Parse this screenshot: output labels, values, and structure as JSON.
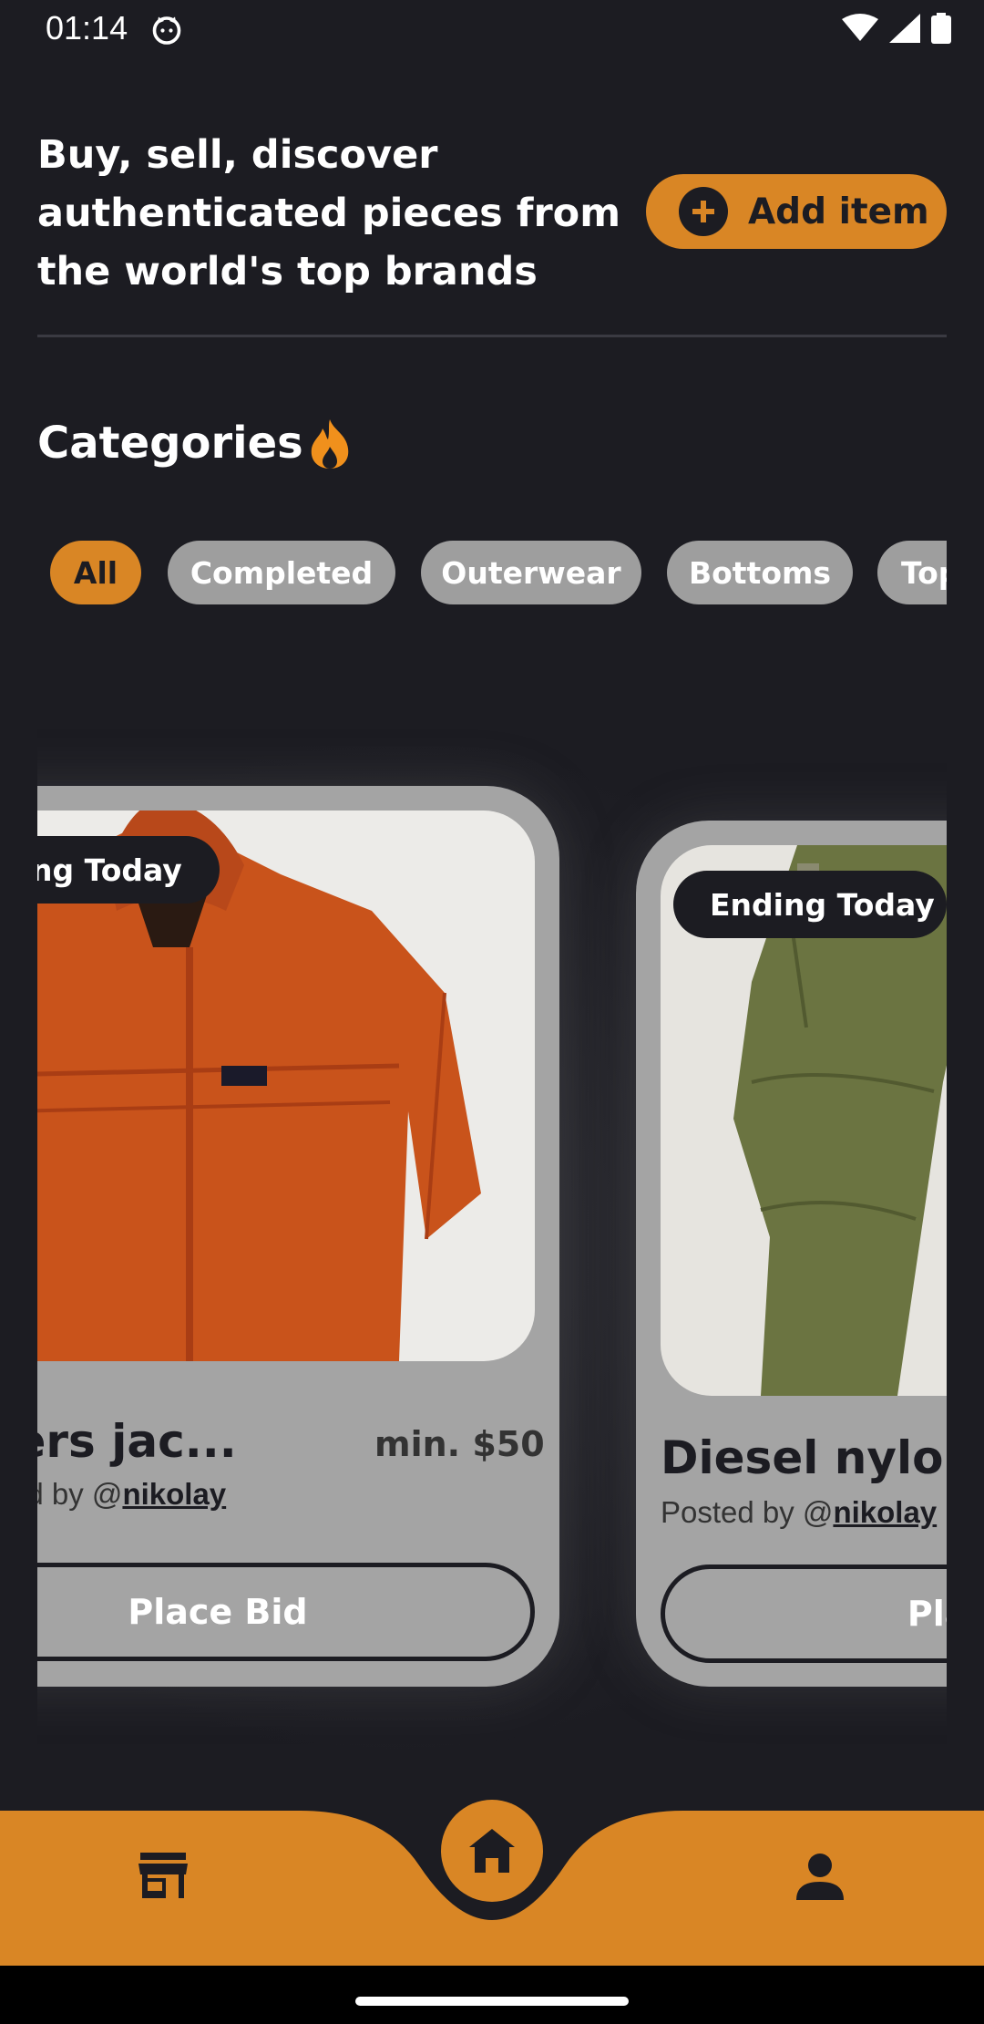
{
  "status_bar": {
    "time": "01:14"
  },
  "header": {
    "hero_text": "Buy, sell, discover authenticated pieces from the world's top brands",
    "add_item_label": "Add item"
  },
  "categories": {
    "title": "Categories",
    "chips": [
      {
        "label": "All",
        "active": true
      },
      {
        "label": "Completed",
        "active": false
      },
      {
        "label": "Outerwear",
        "active": false
      },
      {
        "label": "Bottoms",
        "active": false
      },
      {
        "label": "Tops",
        "active": false
      }
    ]
  },
  "listings": [
    {
      "badge": "Ending Today",
      "title": "Grasshoppers jac...",
      "price": "min. $50",
      "posted_prefix": "Posted by @",
      "username": "nikolay",
      "bid_label": "Place Bid",
      "image": "orange-hooded-jacket"
    },
    {
      "badge": "Ending Today",
      "title": "Diesel nylon",
      "posted_prefix": "Posted by @",
      "username": "nikolay",
      "bid_label": "Place Bid",
      "image": "olive-green-nylon-pants"
    }
  ],
  "nav": {
    "items": [
      "store-icon",
      "home-icon",
      "person-icon"
    ]
  },
  "colors": {
    "background": "#1c1c22",
    "accent": "#d98625",
    "card": "#a4a4a4",
    "chip_inactive": "#9e9e9e"
  }
}
